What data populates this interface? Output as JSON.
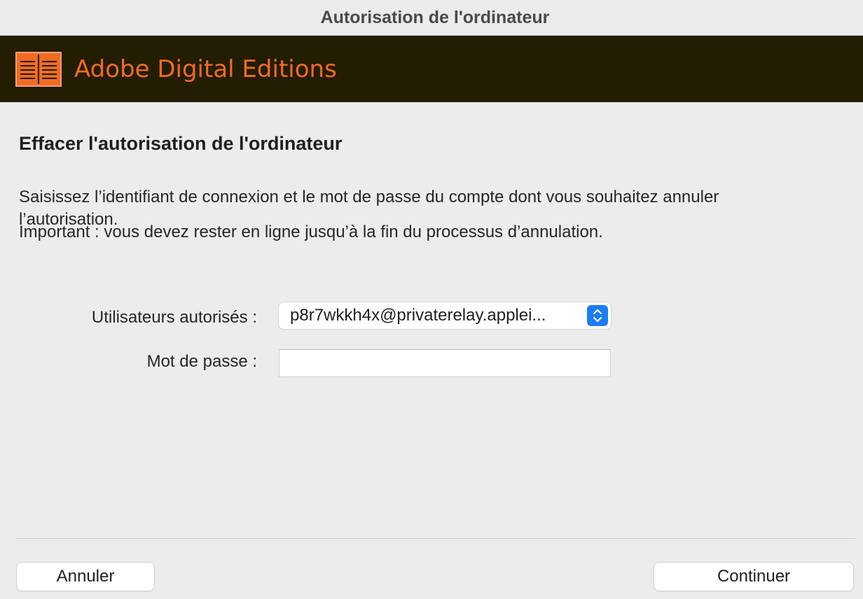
{
  "window": {
    "title": "Autorisation de l'ordinateur"
  },
  "banner": {
    "app_name": "Adobe Digital Editions",
    "logo_icon": "book-icon",
    "background_color": "#231d04",
    "accent_color": "#f26b22"
  },
  "content": {
    "heading": "Effacer l'autorisation de l'ordinateur",
    "instruction": "Saisissez l’identifiant de connexion et le mot de passe du compte dont vous souhaitez annuler l’autorisation.",
    "important": "Important : vous devez rester en ligne jusqu’à la fin du processus d’annulation."
  },
  "form": {
    "users_label": "Utilisateurs autorisés :",
    "users_selected": "p8r7wkkh4x@privaterelay.applei...",
    "users_stepper_icon": "chevron-up-down-icon",
    "password_label": "Mot de passe :",
    "password_value": "",
    "password_placeholder": ""
  },
  "footer": {
    "cancel_label": "Annuler",
    "continue_label": "Continuer"
  }
}
